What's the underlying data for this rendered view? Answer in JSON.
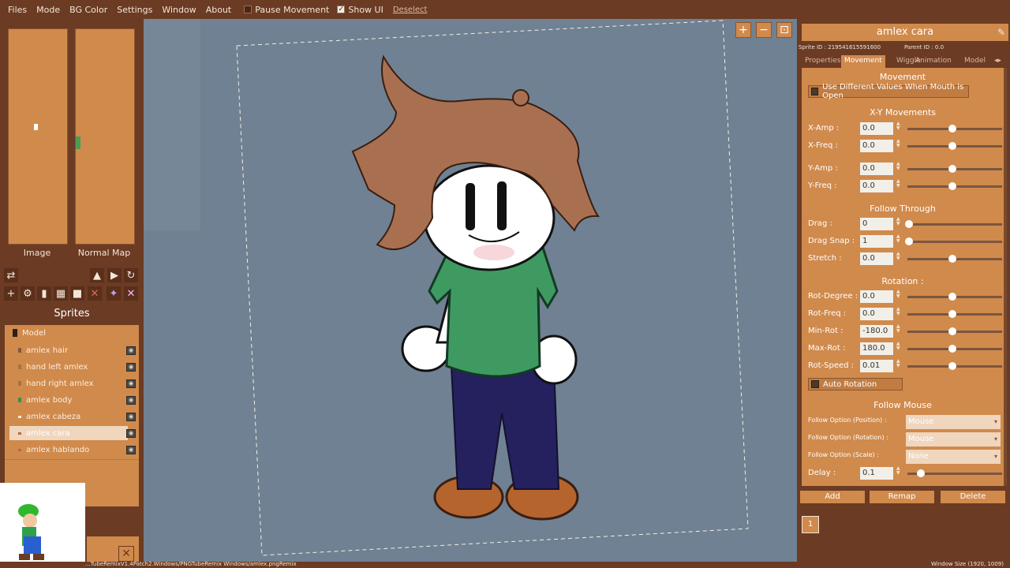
{
  "menu": {
    "items": [
      "Files",
      "Mode",
      "BG Color",
      "Settings",
      "Window",
      "About"
    ],
    "pause_movement": "Pause Movement",
    "show_ui": "Show UI",
    "deselect": "Deselect"
  },
  "left": {
    "image_label": "Image",
    "normal_map_label": "Normal Map",
    "sprites_header": "Sprites",
    "model_label": "Model",
    "sprites": [
      "amlex hair",
      "hand left amlex",
      "hand right amlex",
      "amlex body",
      "amlex cabeza",
      "amlex cara",
      "amlex hablando"
    ],
    "selected_sprite": "amlex cara"
  },
  "status": {
    "path": "...TubeRemixV1.4Patch2.Windows/PNGTubeRemix Windows/amlex.pngRemix",
    "window_size": "Window Size (1920, 1009)"
  },
  "right": {
    "title": "amlex cara",
    "sprite_id": "Sprite ID : 219541615591600",
    "parent_id": "Parent ID : 0.0",
    "tabs": [
      "Properties",
      "Movement",
      "Wiggle",
      "Animation",
      "Model"
    ],
    "active_tab": "Movement",
    "movement_title": "Movement",
    "mouth_open_check": "Use Different Values When Mouth is Open",
    "xy_title": "X-Y Movements",
    "x_amp_label": "X-Amp :",
    "x_amp": "0.0",
    "x_freq_label": "X-Freq :",
    "x_freq": "0.0",
    "y_amp_label": "Y-Amp :",
    "y_amp": "0.0",
    "y_freq_label": "Y-Freq :",
    "y_freq": "0.0",
    "follow_through_title": "Follow Through",
    "drag_label": "Drag :",
    "drag": "0",
    "drag_snap_label": "Drag Snap :",
    "drag_snap": "1",
    "stretch_label": "Stretch :",
    "stretch": "0.0",
    "rotation_title": "Rotation :",
    "rot_degree_label": "Rot-Degree :",
    "rot_degree": "0.0",
    "rot_freq_label": "Rot-Freq :",
    "rot_freq": "0.0",
    "min_rot_label": "Min-Rot :",
    "min_rot": "-180.0",
    "max_rot_label": "Max-Rot :",
    "max_rot": "180.0",
    "rot_speed_label": "Rot-Speed :",
    "rot_speed": "0.01",
    "auto_rotation": "Auto Rotation",
    "follow_mouse_title": "Follow Mouse",
    "follow_pos_label": "Follow Option (Position) :",
    "follow_pos": "Mouse",
    "follow_rot_label": "Follow Option (Rotation) :",
    "follow_rot": "Mouse",
    "follow_scale_label": "Follow Option (Scale) :",
    "follow_scale": "None",
    "delay_label": "Delay :",
    "delay": "0.1",
    "add_button": "Add",
    "remap_button": "Remap",
    "delete_button": "Delete",
    "page_number": "1"
  },
  "colors": {
    "panel": "#6b3b23",
    "accent": "#d08a4c",
    "canvas": "#6f8192"
  }
}
